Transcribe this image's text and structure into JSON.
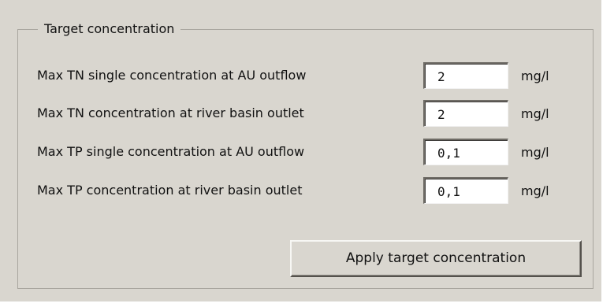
{
  "group": {
    "title": "Target concentration"
  },
  "rows": [
    {
      "label": "Max TN single concentration at AU outflow",
      "value": "2",
      "unit": "mg/l"
    },
    {
      "label": "Max TN concentration at river basin outlet",
      "value": "2",
      "unit": "mg/l"
    },
    {
      "label": "Max TP single concentration at AU outflow",
      "value": "0,1",
      "unit": "mg/l"
    },
    {
      "label": "Max TP concentration at river basin outlet",
      "value": "0,1",
      "unit": "mg/l"
    }
  ],
  "actions": {
    "apply_label": "Apply target concentration"
  }
}
